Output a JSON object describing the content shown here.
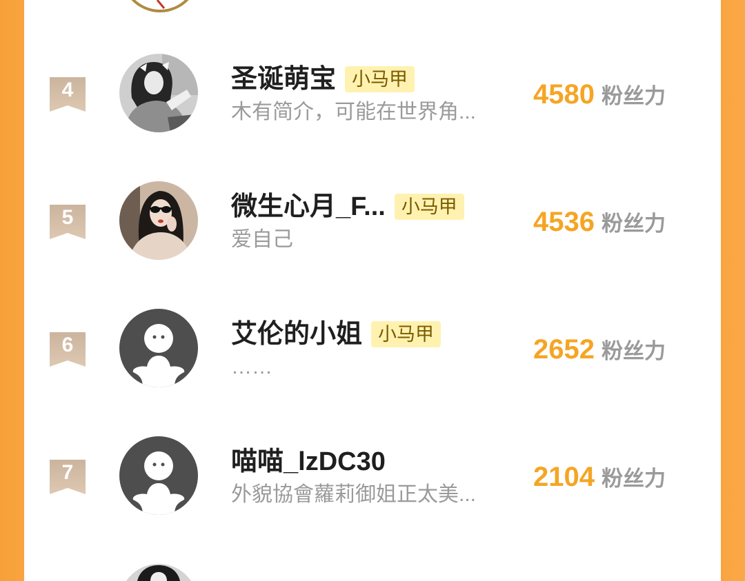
{
  "theme": {
    "frame_color": "#F9A440",
    "accent_color": "#F5A524",
    "tag_bg": "#FFF2B0",
    "tag_text": "#7A5A00",
    "badge_color": "#D6BFA8",
    "muted_text": "#9A9A9A"
  },
  "ranking": {
    "top_partial_row": {
      "avatar": "photo-avatar"
    },
    "rows": [
      {
        "rank": "4",
        "name": "圣诞萌宝",
        "tag": "小马甲",
        "bio": "木有简介，可能在世界角...",
        "score": "4580",
        "score_unit": "粉丝力",
        "avatar": "photo-avatar"
      },
      {
        "rank": "5",
        "name": "微生心月_F...",
        "tag": "小马甲",
        "bio": "爱自己",
        "score": "4536",
        "score_unit": "粉丝力",
        "avatar": "photo-avatar"
      },
      {
        "rank": "6",
        "name": "艾伦的小姐",
        "tag": "小马甲",
        "bio": "……",
        "score": "2652",
        "score_unit": "粉丝力",
        "avatar": "default-avatar-icon"
      },
      {
        "rank": "7",
        "name": "喵喵_lzDC30",
        "bio": "外貌協會蘿莉御姐正太美...",
        "score": "2104",
        "score_unit": "粉丝力",
        "avatar": "default-avatar-icon"
      }
    ],
    "bottom_partial_row": {
      "avatar": "photo-avatar"
    }
  }
}
